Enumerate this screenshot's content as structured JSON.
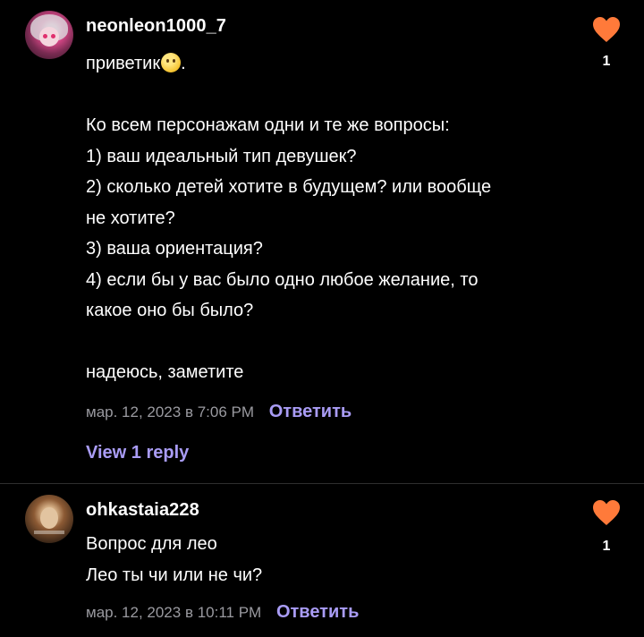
{
  "colors": {
    "background": "#000000",
    "text": "#ffffff",
    "meta": "#9a9aa0",
    "link": "#a99cf5",
    "heart": "#ff7a3a"
  },
  "comments": [
    {
      "username": "neonleon1000_7",
      "avatar_icon": "avatar-anime-character-icon",
      "greeting": "приветик",
      "greeting_tail": ".",
      "emoji_icon": "smiling-face-emoji-icon",
      "body": "\nКо всем персонажам одни и те же вопросы:\n1) ваш идеальный тип девушек?\n2) сколько детей хотите в будущем? или вообще\nне хотите?\n3) ваша ориентация?\n4) если бы у вас было одно любое желание, то\nкакое оно бы было?\n\nнадеюсь, заметите",
      "timestamp": "мар. 12, 2023 в 7:06 PM",
      "reply_label": "Ответить",
      "likes": "1",
      "view_replies_label": "View 1 reply"
    },
    {
      "username": "ohkastaia228",
      "avatar_icon": "avatar-photo-icon",
      "body": "Вопрос для лео\nЛео ты чи или не чи?",
      "timestamp": "мар. 12, 2023 в 10:11 PM",
      "reply_label": "Ответить",
      "likes": "1"
    }
  ]
}
